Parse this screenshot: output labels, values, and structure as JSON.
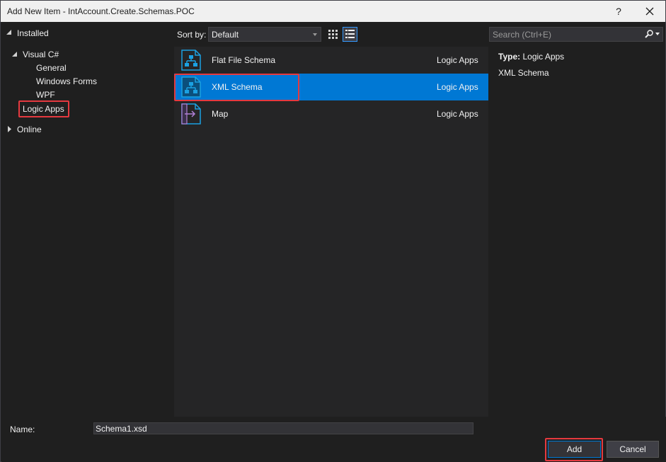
{
  "window": {
    "title": "Add New Item - IntAccount.Create.Schemas.POC",
    "help_label": "?",
    "close_label": "✕"
  },
  "tree": {
    "installed": "Installed",
    "visual_csharp": "Visual C#",
    "general": "General",
    "windows_forms": "Windows Forms",
    "wpf": "WPF",
    "logic_apps": "Logic Apps",
    "online": "Online"
  },
  "toolbar": {
    "sort_label": "Sort by:",
    "sort_value": "Default"
  },
  "search": {
    "placeholder": "Search (Ctrl+E)"
  },
  "items": [
    {
      "name": "Flat File Schema",
      "category": "Logic Apps",
      "icon": "schema-icon"
    },
    {
      "name": "XML Schema",
      "category": "Logic Apps",
      "icon": "schema-icon"
    },
    {
      "name": "Map",
      "category": "Logic Apps",
      "icon": "map-icon"
    }
  ],
  "detail": {
    "type_label": "Type:",
    "type_value": "Logic Apps",
    "description": "XML Schema"
  },
  "bottom": {
    "name_label": "Name:",
    "name_value": "Schema1.xsd",
    "add_label": "Add",
    "cancel_label": "Cancel"
  },
  "colors": {
    "accent": "#0078d4",
    "highlight": "#e5393f",
    "icon_teal": "#1ba1e2",
    "map_arrow": "#b180d7"
  }
}
